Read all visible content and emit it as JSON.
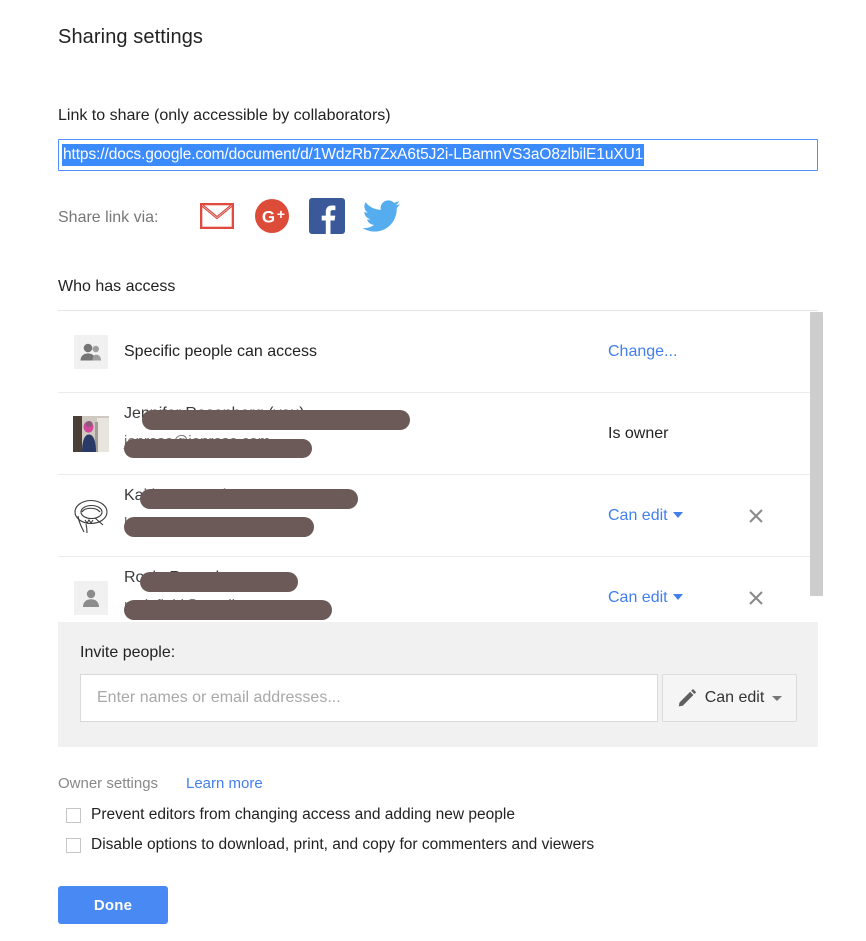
{
  "dialog": {
    "title": "Sharing settings"
  },
  "link_section": {
    "label": "Link to share (only accessible by collaborators)",
    "url": "https://docs.google.com/document/d/1WdzRb7ZxA6t5J2i-LBamnVS3aO8zlbilE1uXU1",
    "selected": true
  },
  "share_via": {
    "label": "Share link via:",
    "icons": [
      {
        "name": "gmail-icon",
        "title": "Gmail",
        "color": "#d44638"
      },
      {
        "name": "google-plus-icon",
        "title": "Google+",
        "color": "#dd4b39"
      },
      {
        "name": "facebook-icon",
        "title": "Facebook",
        "color": "#3b5998"
      },
      {
        "name": "twitter-icon",
        "title": "Twitter",
        "color": "#55acee"
      }
    ]
  },
  "access_section": {
    "label": "Who has access",
    "rows": [
      {
        "avatar": "people-icon",
        "label": "Specific people can access",
        "action_label": "Change...",
        "action_type": "link",
        "redacted": false,
        "has_remove": false
      },
      {
        "avatar": "photo-avatar",
        "name_text": "Jennifer Rosenberg (you)",
        "email_text": "jenrose@jenrose.com",
        "action_label": "Is owner",
        "action_type": "static",
        "redacted": true,
        "has_remove": false
      },
      {
        "avatar": "sketch-avatar",
        "name_text": "Kaitlyn Rosenberg",
        "email_text": "krosenberg@gmail.com",
        "action_label": "Can edit",
        "action_type": "dropdown",
        "redacted": true,
        "has_remove": true
      },
      {
        "avatar": "person-icon",
        "name_text": "Rosie Rosenberg",
        "email_text": "rosiefield@gmail.com",
        "action_label": "Can edit",
        "action_type": "dropdown",
        "redacted": true,
        "has_remove": true
      }
    ]
  },
  "invite_section": {
    "label": "Invite people:",
    "input_value": "",
    "input_placeholder": "Enter names or email addresses...",
    "role_label": "Can edit",
    "role_icon": "pencil-icon"
  },
  "owner_settings": {
    "label": "Owner settings",
    "learn_more_label": "Learn more",
    "checkboxes": [
      {
        "label": "Prevent editors from changing access and adding new people",
        "checked": false
      },
      {
        "label": "Disable options to download, print, and copy for commenters and viewers",
        "checked": false
      }
    ]
  },
  "footer": {
    "done_label": "Done"
  },
  "colors": {
    "link_blue": "#427fed",
    "button_blue": "#4989f3",
    "selection_blue": "#3b8bfd",
    "redaction": "#6b5a57",
    "panel_gray": "#f1f1f1"
  }
}
